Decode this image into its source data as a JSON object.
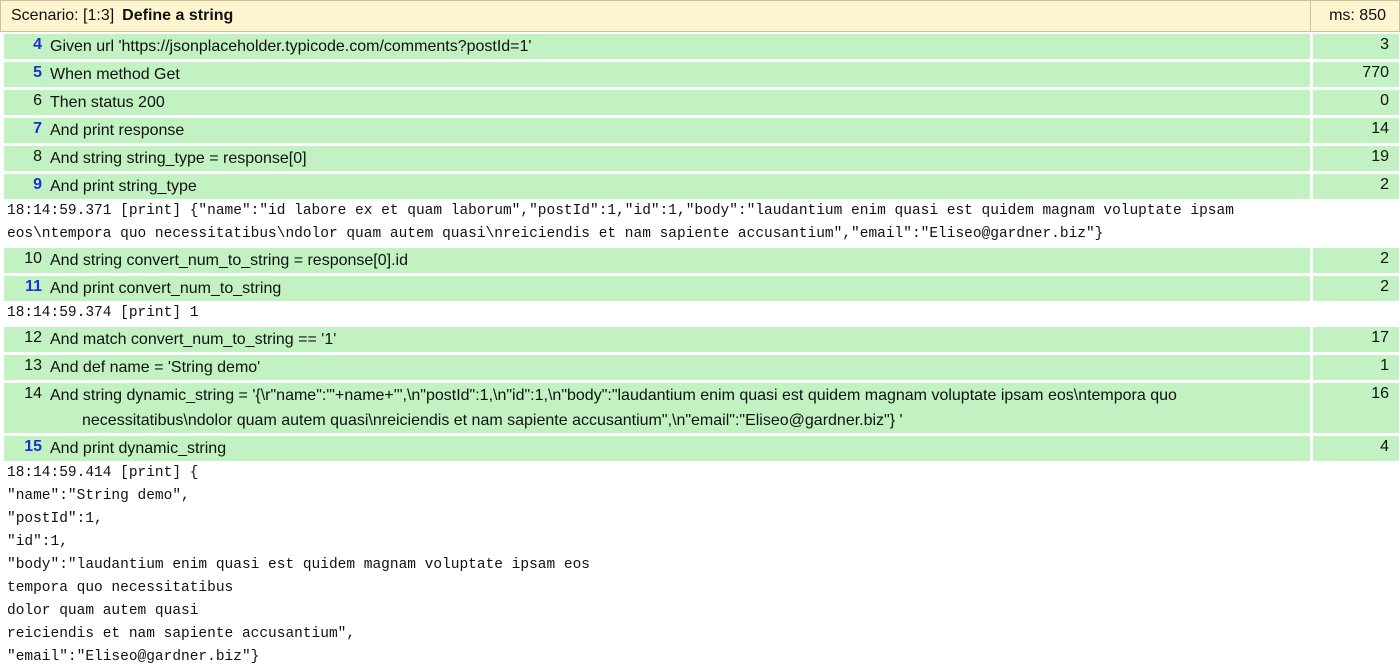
{
  "scenario": {
    "label": "Scenario: [1:3]",
    "name": "Define a string",
    "ms": "ms: 850"
  },
  "steps": [
    {
      "line": "4",
      "text": "Given url 'https://jsonplaceholder.typicode.com/comments?postId=1'",
      "ms": "3",
      "link": true
    },
    {
      "line": "5",
      "text": "When method Get",
      "ms": "770",
      "link": true
    },
    {
      "line": "6",
      "text": "Then status 200",
      "ms": "0",
      "link": false
    },
    {
      "line": "7",
      "text": "And print response",
      "ms": "14",
      "link": true
    },
    {
      "line": "8",
      "text": "And string string_type = response[0]",
      "ms": "19",
      "link": false
    },
    {
      "line": "9",
      "text": "And print string_type",
      "ms": "2",
      "link": true
    },
    {
      "line": "10",
      "text": "And string convert_num_to_string = response[0].id",
      "ms": "2",
      "link": false
    },
    {
      "line": "11",
      "text": "And print convert_num_to_string",
      "ms": "2",
      "link": true
    },
    {
      "line": "12",
      "text": "And match convert_num_to_string == '1'",
      "ms": "17",
      "link": false
    },
    {
      "line": "13",
      "text": "And def name = 'String demo'",
      "ms": "1",
      "link": false
    },
    {
      "line": "14",
      "text": "And string dynamic_string = '{\\r\"name\":\"'+name+'\",\\n\"postId\":1,\\n\"id\":1,\\n\"body\":\"laudantium enim quasi est quidem magnam voluptate ipsam eos\\ntempora quo",
      "text2": "necessitatibus\\ndolor quam autem quasi\\nreiciendis et nam sapiente accusantium\",\\n\"email\":\"Eliseo@gardner.biz\"} '",
      "ms": "16",
      "link": false
    },
    {
      "line": "15",
      "text": "And print dynamic_string",
      "ms": "4",
      "link": true
    }
  ],
  "logs": {
    "log1_line1": "18:14:59.371 [print] {\"name\":\"id labore ex et quam laborum\",\"postId\":1,\"id\":1,\"body\":\"laudantium enim quasi est quidem magnam voluptate ipsam",
    "log1_line2": "eos\\ntempora quo necessitatibus\\ndolor quam autem quasi\\nreiciendis et nam sapiente accusantium\",\"email\":\"Eliseo@gardner.biz\"}",
    "log2": "18:14:59.374 [print] 1",
    "log3": [
      "18:14:59.414 [print] {",
      "\"name\":\"String demo\",",
      "\"postId\":1,",
      "\"id\":1,",
      "\"body\":\"laudantium enim quasi est quidem magnam voluptate ipsam eos",
      "tempora quo necessitatibus",
      "dolor quam autem quasi",
      "reiciendis et nam sapiente accusantium\",",
      "\"email\":\"Eliseo@gardner.biz\"}"
    ]
  },
  "colors": {
    "header_bg": "#fdf5d0",
    "step_bg": "#c2f2c2",
    "link_line": "#1a2fd6"
  }
}
